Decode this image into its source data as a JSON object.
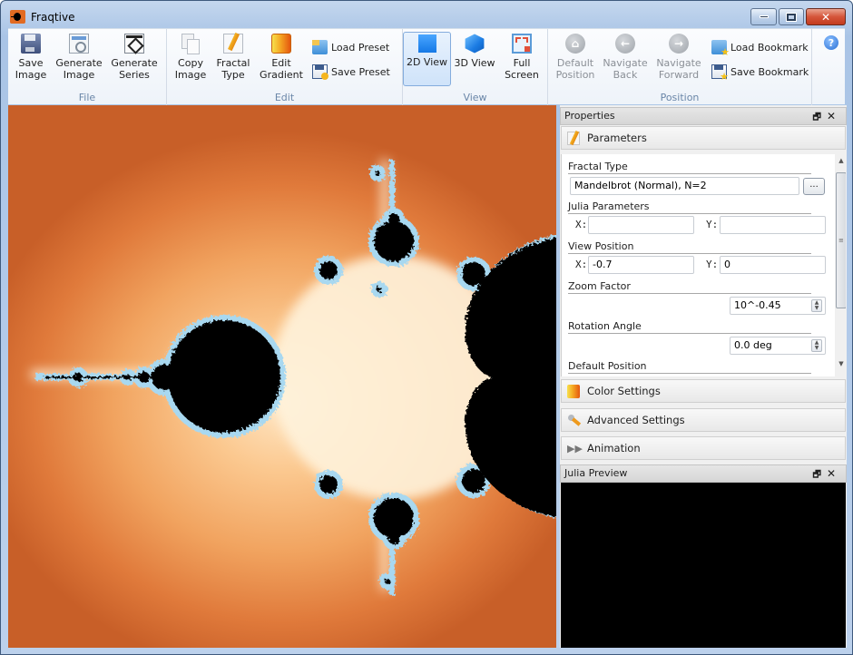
{
  "window": {
    "title": "Fraqtive",
    "controls": {
      "minimize": "minimize",
      "maximize": "maximize",
      "close": "✕"
    }
  },
  "ribbon": {
    "groups": [
      {
        "label": "File",
        "buttons": [
          {
            "label_line1": "Save",
            "label_line2": "Image",
            "icon": "floppy-icon",
            "enabled": true
          },
          {
            "label_line1": "Generate",
            "label_line2": "Image",
            "icon": "generate-image-icon",
            "enabled": true
          },
          {
            "label_line1": "Generate",
            "label_line2": "Series",
            "icon": "generate-series-icon",
            "enabled": true
          }
        ]
      },
      {
        "label": "Edit",
        "buttons": [
          {
            "label_line1": "Copy",
            "label_line2": "Image",
            "icon": "copy-icon",
            "enabled": true
          },
          {
            "label_line1": "Fractal",
            "label_line2": "Type",
            "icon": "pencil-icon",
            "enabled": true
          },
          {
            "label_line1": "Edit",
            "label_line2": "Gradient",
            "icon": "gradient-icon",
            "enabled": true
          }
        ],
        "small_buttons": [
          {
            "label": "Load Preset",
            "icon": "load-preset-icon"
          },
          {
            "label": "Save Preset",
            "icon": "save-preset-icon"
          }
        ]
      },
      {
        "label": "View",
        "buttons": [
          {
            "label_line1": "2D View",
            "label_line2": "",
            "icon": "square-2d-icon",
            "active": true
          },
          {
            "label_line1": "3D View",
            "label_line2": "",
            "icon": "cube-3d-icon",
            "active": false
          },
          {
            "label_line1": "Full",
            "label_line2": "Screen",
            "icon": "fullscreen-icon",
            "active": false
          }
        ]
      },
      {
        "label": "Position",
        "buttons": [
          {
            "label_line1": "Default",
            "label_line2": "Position",
            "icon": "home-icon",
            "glyph": "⌂",
            "enabled": false
          },
          {
            "label_line1": "Navigate",
            "label_line2": "Back",
            "icon": "back-arrow-icon",
            "glyph": "←",
            "enabled": false
          },
          {
            "label_line1": "Navigate",
            "label_line2": "Forward",
            "icon": "forward-arrow-icon",
            "glyph": "→",
            "enabled": false
          }
        ],
        "small_buttons": [
          {
            "label": "Load Bookmark",
            "icon": "load-bookmark-icon"
          },
          {
            "label": "Save Bookmark",
            "icon": "save-bookmark-icon"
          }
        ]
      }
    ],
    "help_glyph": "?"
  },
  "dock": {
    "properties": {
      "title": "Properties",
      "float_glyph": "🗗",
      "close_glyph": "✕",
      "sections": {
        "parameters": "Parameters",
        "color_settings": "Color Settings",
        "advanced_settings": "Advanced Settings",
        "animation": "Animation"
      },
      "fields": {
        "fractal_type_label": "Fractal Type",
        "fractal_type_value": "Mandelbrot (Normal), N=2",
        "fractal_type_button": "...",
        "julia_label": "Julia Parameters",
        "julia_x_label": "X:",
        "julia_x_value": "",
        "julia_y_label": "Y:",
        "julia_y_value": "",
        "view_position_label": "View Position",
        "view_x_label": "X:",
        "view_x_value": "-0.7",
        "view_y_label": "Y:",
        "view_y_value": "0",
        "zoom_label": "Zoom Factor",
        "zoom_value": "10^-0.45",
        "rotation_label": "Rotation Angle",
        "rotation_value": "0.0 deg",
        "default_position_label": "Default Position"
      },
      "spin_up": "▲",
      "spin_down": "▼",
      "scroll_up": "▲",
      "scroll_down": "▼",
      "scroll_grip": "≡"
    },
    "julia_preview": {
      "title": "Julia Preview",
      "float_glyph": "🗗",
      "close_glyph": "✕"
    }
  },
  "fractal_view": {
    "fractal": "Mandelbrot",
    "center_x": -0.7,
    "center_y": 0,
    "set_color": "#000000",
    "edge_color": "#a8d8f0",
    "gradient_inner": "#ffe6c4",
    "gradient_outer": "#c85f28"
  }
}
